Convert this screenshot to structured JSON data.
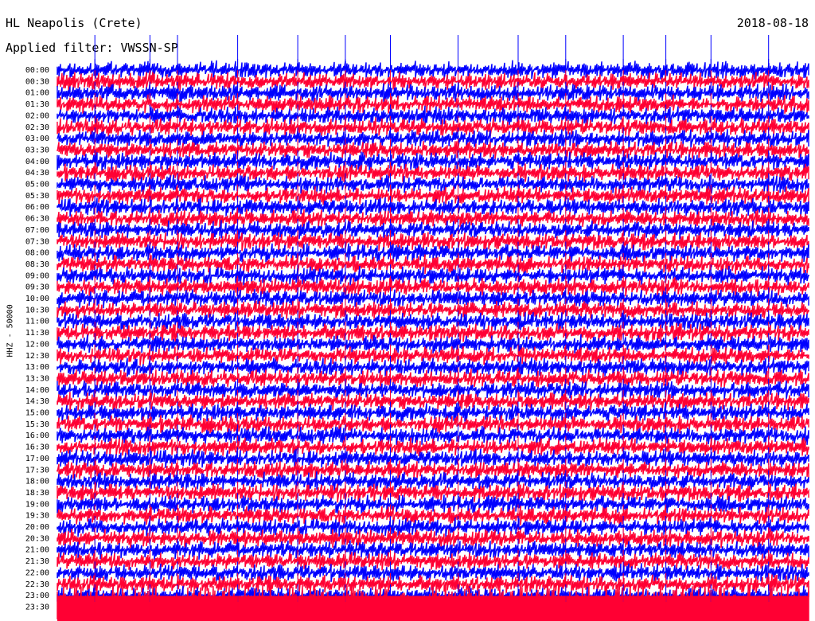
{
  "header": {
    "station": "HL Neapolis (Crete)",
    "filter": "Applied filter: VWSSN-SP",
    "date": "2018-08-18"
  },
  "chart_data": {
    "type": "line",
    "title": "HL Neapolis (Crete)",
    "subtitle": "Applied filter: VWSSN-SP",
    "date": "2018-08-18",
    "ylabel": "HHZ - 50000",
    "ytick_labels": [
      "00:00",
      "00:30",
      "01:00",
      "01:30",
      "02:00",
      "02:30",
      "03:00",
      "03:30",
      "04:00",
      "04:30",
      "05:00",
      "05:30",
      "06:00",
      "06:30",
      "07:00",
      "07:30",
      "08:00",
      "08:30",
      "09:00",
      "09:30",
      "10:00",
      "10:30",
      "11:00",
      "11:30",
      "12:00",
      "12:30",
      "13:00",
      "13:30",
      "14:00",
      "14:30",
      "15:00",
      "15:30",
      "16:00",
      "16:30",
      "17:00",
      "17:30",
      "18:00",
      "18:30",
      "19:00",
      "19:30",
      "20:00",
      "20:30",
      "21:00",
      "21:30",
      "22:00",
      "22:30",
      "23:00",
      "23:30"
    ],
    "series_colors": [
      "#0000ff",
      "#ff0033"
    ],
    "trace_minutes": 30,
    "events_minutes_into_trace": [
      1.5,
      3.7,
      4.8,
      7.2,
      9.6,
      11.5,
      13.3,
      16.0,
      18.4,
      20.3,
      22.6,
      24.3,
      26.1,
      28.4
    ],
    "grid": false
  }
}
